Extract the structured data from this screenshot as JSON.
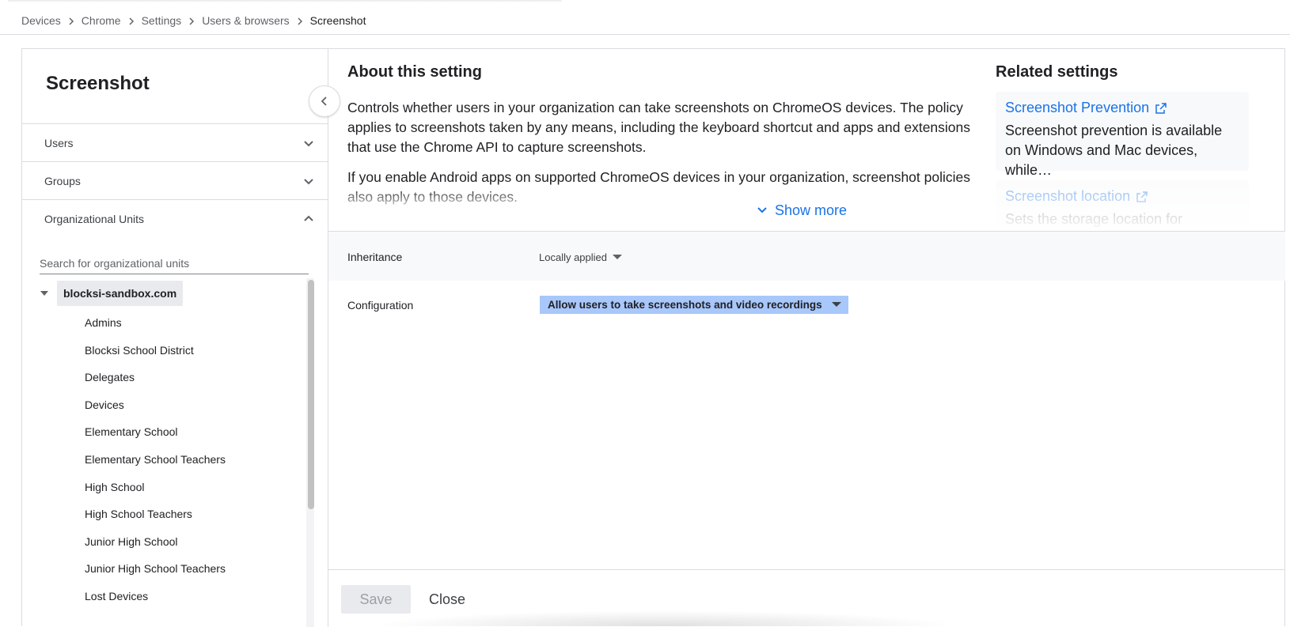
{
  "breadcrumb": {
    "items": [
      "Devices",
      "Chrome",
      "Settings",
      "Users & browsers"
    ],
    "current": "Screenshot"
  },
  "left_panel": {
    "title": "Screenshot",
    "accordions": {
      "users": "Users",
      "groups": "Groups",
      "org_units": "Organizational Units"
    },
    "search_placeholder": "Search for organizational units",
    "root": "blocksi-sandbox.com",
    "units": [
      "Admins",
      "Blocksi School District",
      "Delegates",
      "Devices",
      "Elementary School",
      "Elementary School Teachers",
      "High School",
      "High School Teachers",
      "Junior High School",
      "Junior High School Teachers",
      "Lost Devices"
    ]
  },
  "about": {
    "title": "About this setting",
    "paragraph1": "Controls whether users in your organization can take screenshots on ChromeOS devices. The policy applies to screenshots taken by any means, including the keyboard shortcut and apps and extensions that use the Chrome API to capture screenshots.",
    "paragraph2": "If you enable Android apps on supported ChromeOS devices in your organization, screenshot policies also apply to those devices.",
    "show_more": "Show more"
  },
  "related": {
    "title": "Related settings",
    "cards": [
      {
        "link": "Screenshot Prevention",
        "desc": "Screenshot prevention is available on Windows and Mac devices, while…"
      },
      {
        "link": "Screenshot location",
        "desc": "Sets the storage location for screen…"
      }
    ]
  },
  "settings": {
    "inheritance_label": "Inheritance",
    "inheritance_value": "Locally applied",
    "configuration_label": "Configuration",
    "configuration_value": "Allow users to take screenshots and video recordings"
  },
  "footer": {
    "save": "Save",
    "close": "Close"
  },
  "colors": {
    "accent": "#1a73e8",
    "config_highlight": "#a8c7fa"
  }
}
